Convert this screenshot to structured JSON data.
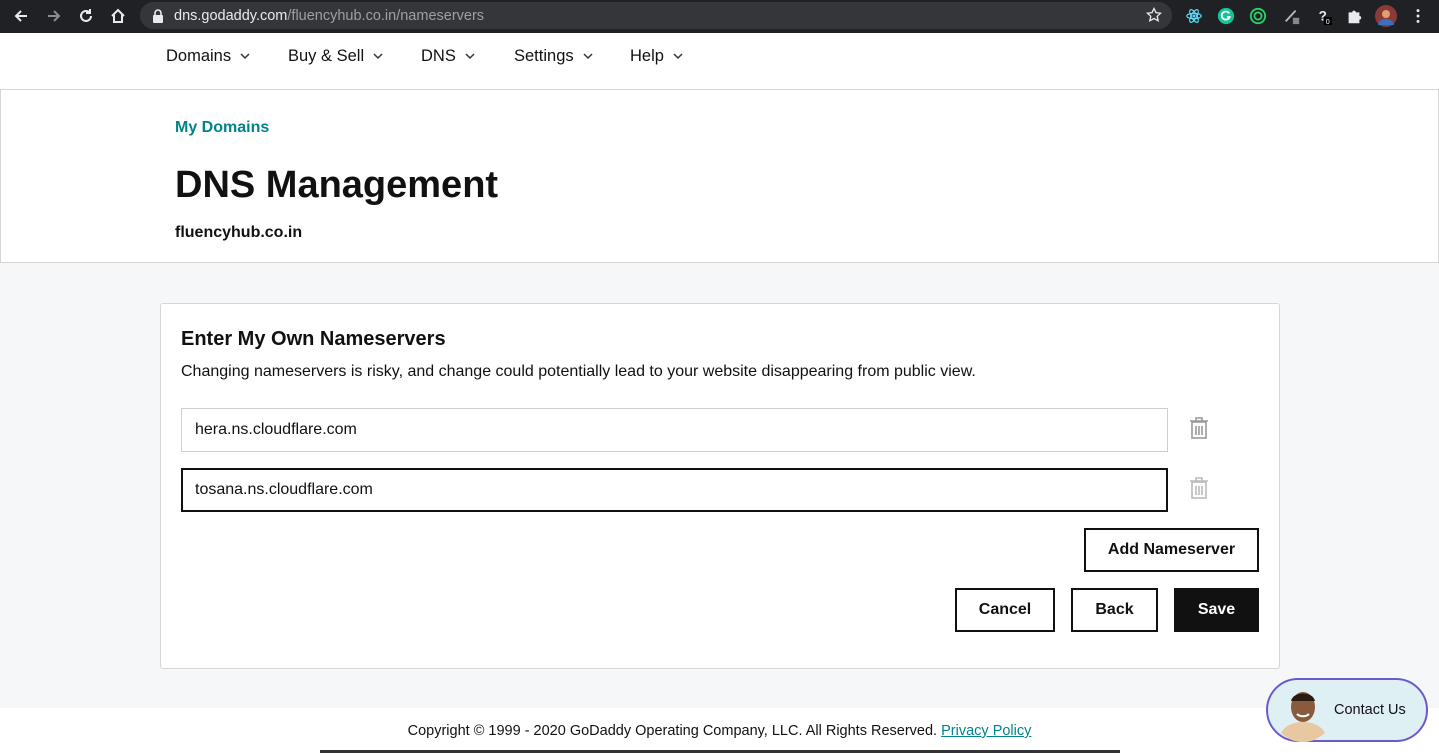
{
  "browser": {
    "url_host": "dns.godaddy.com",
    "url_path": "/fluencyhub.co.in/nameservers",
    "extension_badge": "0"
  },
  "nav": {
    "items": [
      {
        "label": "Domains"
      },
      {
        "label": "Buy & Sell"
      },
      {
        "label": "DNS"
      },
      {
        "label": "Settings"
      },
      {
        "label": "Help"
      }
    ]
  },
  "header": {
    "breadcrumb": "My Domains",
    "title": "DNS Management",
    "domain": "fluencyhub.co.in"
  },
  "card": {
    "title": "Enter My Own Nameservers",
    "description": "Changing nameservers is risky, and change could potentially lead to your website disappearing from public view.",
    "nameservers": [
      {
        "value": "hera.ns.cloudflare.com"
      },
      {
        "value": "tosana.ns.cloudflare.com"
      }
    ],
    "add_label": "Add Nameserver",
    "cancel_label": "Cancel",
    "back_label": "Back",
    "save_label": "Save"
  },
  "footer": {
    "copyright": "Copyright © 1999 - 2020 GoDaddy Operating Company, LLC. All Rights Reserved.",
    "privacy_label": "Privacy Policy"
  },
  "contact": {
    "label": "Contact Us"
  },
  "colors": {
    "accent": "#00838c",
    "primary_button": "#111111",
    "chrome_bg": "#202124"
  }
}
